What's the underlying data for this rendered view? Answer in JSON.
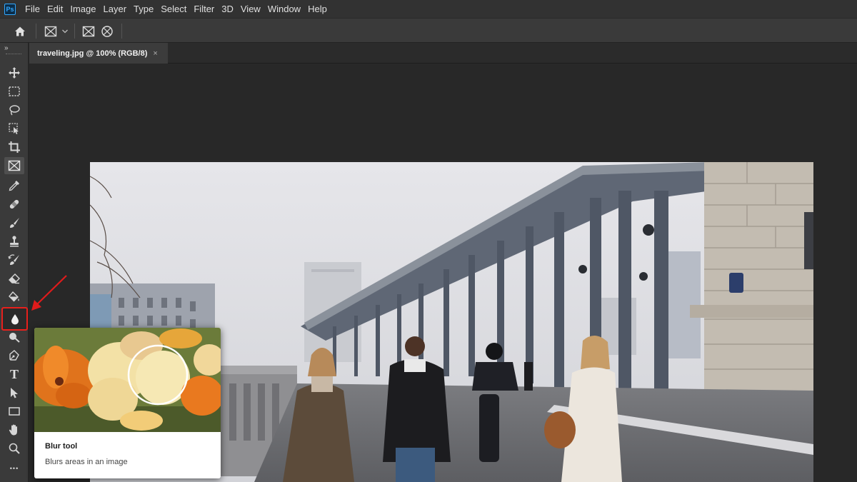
{
  "app": {
    "logo": "Ps"
  },
  "menu": [
    "File",
    "Edit",
    "Image",
    "Layer",
    "Type",
    "Select",
    "Filter",
    "3D",
    "View",
    "Window",
    "Help"
  ],
  "options_bar": {
    "icons": [
      "home-icon",
      "frame-rect-icon",
      "chevron-down-icon",
      "frame-rect-icon",
      "frame-ellipse-icon"
    ]
  },
  "toolbar": {
    "collapse_glyph": "»",
    "tools": [
      {
        "name": "move-tool",
        "icon": "move-icon"
      },
      {
        "name": "marquee-tool",
        "icon": "marquee-icon"
      },
      {
        "name": "lasso-tool",
        "icon": "lasso-icon"
      },
      {
        "name": "object-selection-tool",
        "icon": "object-selection-icon"
      },
      {
        "name": "crop-tool",
        "icon": "crop-icon"
      },
      {
        "name": "frame-tool",
        "icon": "frame-icon"
      },
      {
        "name": "eyedropper-tool",
        "icon": "eyedropper-icon"
      },
      {
        "name": "healing-brush-tool",
        "icon": "bandage-icon"
      },
      {
        "name": "brush-tool",
        "icon": "brush-icon"
      },
      {
        "name": "clone-stamp-tool",
        "icon": "stamp-icon"
      },
      {
        "name": "history-brush-tool",
        "icon": "history-brush-icon"
      },
      {
        "name": "eraser-tool",
        "icon": "eraser-icon"
      },
      {
        "name": "paint-bucket-tool",
        "icon": "paint-bucket-icon"
      },
      {
        "name": "blur-tool",
        "icon": "droplet-icon"
      },
      {
        "name": "dodge-tool",
        "icon": "dodge-icon"
      },
      {
        "name": "pen-tool",
        "icon": "pen-icon"
      },
      {
        "name": "type-tool",
        "icon": "type-icon",
        "glyph": "T"
      },
      {
        "name": "path-selection-tool",
        "icon": "arrow-pointer-icon"
      },
      {
        "name": "rectangle-tool",
        "icon": "rectangle-icon"
      },
      {
        "name": "hand-tool",
        "icon": "hand-icon"
      },
      {
        "name": "zoom-tool",
        "icon": "zoom-icon"
      },
      {
        "name": "more-tools",
        "icon": "ellipsis-icon",
        "glyph": "•••"
      }
    ]
  },
  "document": {
    "tab_label": "traveling.jpg @ 100% (RGB/8)",
    "close_glyph": "×"
  },
  "tooltip": {
    "title": "Blur tool",
    "description": "Blurs areas in an image"
  },
  "colors": {
    "accent_highlight": "#e8201c",
    "ps_blue": "#31a8ff"
  }
}
